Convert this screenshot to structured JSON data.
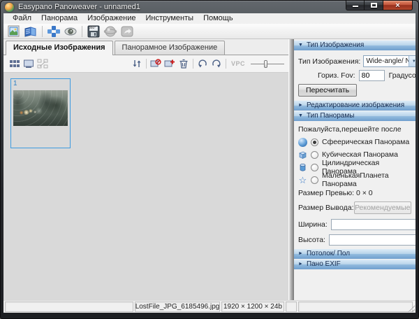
{
  "window": {
    "title": "Easypano Panoweaver - unnamed1"
  },
  "window_controls": {
    "close_glyph": "×"
  },
  "menu": {
    "items": [
      "Файл",
      "Панорама",
      "Изображение",
      "Инструменты",
      "Помощь"
    ]
  },
  "toolbar": {
    "save_badge": "360°",
    "icons": [
      "open-image-icon",
      "open-project-icon",
      "stitch-icon",
      "preview-icon",
      "save-panorama-icon",
      "publish-icon",
      "share-icon"
    ]
  },
  "tabs": {
    "source_label": "Исходные Изображения",
    "panorama_label": "Панорамное Изображение"
  },
  "image_toolbar": {
    "vpc_label": "VPC",
    "icons": [
      "thumbnail-view-icon",
      "large-view-icon",
      "compare-view-icon",
      "sort-icon",
      "exclude-image-icon",
      "add-image-icon",
      "delete-image-icon",
      "rotate-ccw-icon",
      "rotate-cw-icon",
      "zoom-slider"
    ]
  },
  "thumbnail": {
    "index": "1"
  },
  "right_panel": {
    "image_type": {
      "header": "Тип Изображения",
      "type_label": "Тип Изображения:",
      "type_value": "Wide-angle/ N",
      "fov_label": "Гориз. Fov:",
      "fov_value": "80",
      "fov_unit": "Градусов",
      "recalc_button": "Пересчитать"
    },
    "editing": {
      "header": "Редактирование изображения"
    },
    "pano_type": {
      "header": "Тип Панорамы",
      "note": "Пожалуйста,перешейте после",
      "options": [
        {
          "label": "Сфеерическая Панорама",
          "selected": true,
          "icon": "sphere-icon"
        },
        {
          "label": "Кубическая Панорама",
          "selected": false,
          "icon": "cube-icon"
        },
        {
          "label": "Цилиндрическая Панорама",
          "selected": false,
          "icon": "cylinder-icon"
        },
        {
          "label": "МаленькаяПланета Панорама",
          "selected": false,
          "icon": "little-planet-icon"
        }
      ],
      "preview_size_label": "Размер Превью:",
      "preview_size_value": "0 × 0",
      "output_size_label": "Размер Вывода:",
      "recommended_button": "Рекомендуемые",
      "width_label": "Ширина:",
      "height_label": "Высота:"
    },
    "ceiling": {
      "header": "Потолок/ Пол"
    },
    "exif": {
      "header": "Пано EXIF"
    }
  },
  "status_bar": {
    "filename": "LostFile_JPG_6185496.jpg",
    "dimensions": "1920 × 1200 × 24b"
  },
  "glyphs": {
    "expanded": "▼",
    "collapsed": "►",
    "dropdown": "▼",
    "star": "☆"
  },
  "colors": {
    "header_gradient_top": "#dcebf7",
    "header_gradient_bottom": "#6f9fce",
    "selection_blue": "#3d9be0",
    "close_button_red": "#b2472c",
    "panel_background": "#f0f0f0",
    "workspace_background": "#d9d9d9"
  }
}
